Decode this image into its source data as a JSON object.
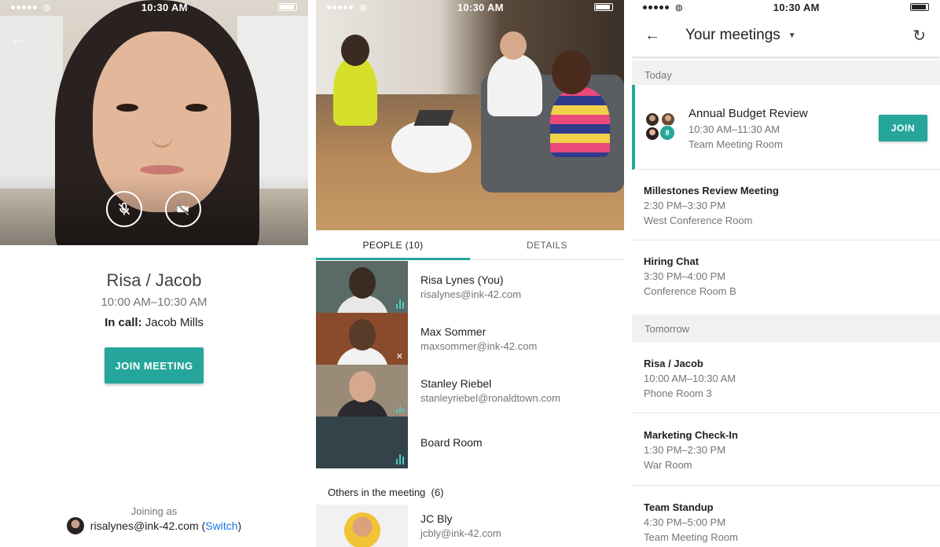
{
  "status_bar": {
    "time": "10:30 AM"
  },
  "screen1": {
    "meeting_title": "Risa / Jacob",
    "meeting_time": "10:00 AM–10:30 AM",
    "in_call_label": "In call:",
    "in_call_name": "Jacob Mills",
    "join_button": "JOIN MEETING",
    "joining_as_label": "Joining as",
    "account_email": "risalynes@ink-42.com",
    "switch_open": "(",
    "switch_label": "Switch",
    "switch_close": ")",
    "icons": {
      "back": "arrow-back-icon",
      "mic": "mic-off-icon",
      "camera": "videocam-off-icon"
    }
  },
  "screen2": {
    "tabs": [
      {
        "label": "PEOPLE (10)",
        "active": true
      },
      {
        "label": "DETAILS",
        "active": false
      }
    ],
    "people": [
      {
        "name": "Risa Lynes (You)",
        "email": "risalynes@ink-42.com",
        "status": "speaking"
      },
      {
        "name": "Max Sommer",
        "email": "maxsommer@ink-42.com",
        "status": "muted"
      },
      {
        "name": "Stanley Riebel",
        "email": "stanleyriebel@ronaldtown.com",
        "status": "speaking"
      },
      {
        "name": "Board Room",
        "email": "",
        "status": "speaking"
      }
    ],
    "others_header": "Others in the meeting",
    "others_count": "(6)",
    "others": [
      {
        "name": "JC Bly",
        "email": "jcbly@ink-42.com"
      }
    ]
  },
  "screen3": {
    "title": "Your meetings",
    "icons": {
      "back": "arrow-back-icon",
      "dropdown": "caret-down-icon",
      "refresh": "refresh-icon"
    },
    "sections": [
      {
        "label": "Today",
        "meetings": [
          {
            "name": "Annual Budget Review",
            "time": "10:30 AM–11:30 AM",
            "room": "Team Meeting Room",
            "attendee_badge": "8",
            "join_label": "JOIN",
            "featured": true
          },
          {
            "name": "Millestones Review Meeting",
            "time": "2:30 PM–3:30 PM",
            "room": "West Conference Room"
          },
          {
            "name": "Hiring Chat",
            "time": "3:30 PM–4:00 PM",
            "room": "Conference Room B"
          }
        ]
      },
      {
        "label": "Tomorrow",
        "meetings": [
          {
            "name": "Risa / Jacob",
            "time": "10:00 AM–10:30 AM",
            "room": "Phone Room 3"
          },
          {
            "name": "Marketing Check-In",
            "time": "1:30 PM–2:30 PM",
            "room": "War Room"
          },
          {
            "name": "Team Standup",
            "time": "4:30 PM–5:00 PM",
            "room": "Team Meeting Room"
          }
        ]
      }
    ]
  },
  "colors": {
    "accent": "#26a69a",
    "link": "#1a73e8",
    "section_bg": "#f1f1f1"
  }
}
